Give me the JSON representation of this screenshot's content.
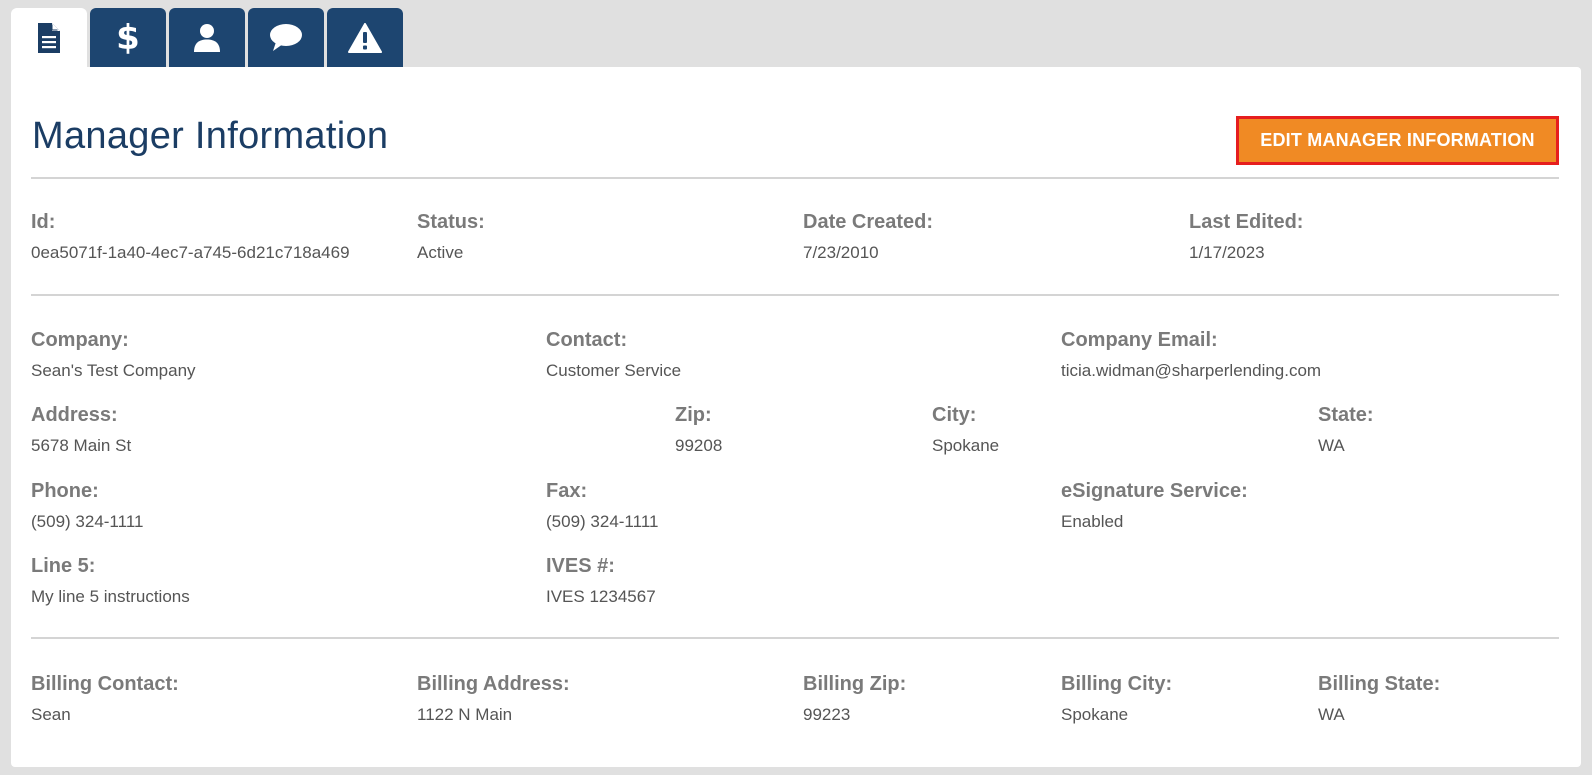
{
  "tabs": [
    {
      "name": "document",
      "icon": "document-icon",
      "active": true
    },
    {
      "name": "billing",
      "icon": "dollar-icon",
      "symbol": "$",
      "active": false
    },
    {
      "name": "user",
      "icon": "user-icon",
      "active": false
    },
    {
      "name": "comments",
      "icon": "chat-bubble-icon",
      "active": false
    },
    {
      "name": "alerts",
      "icon": "warning-icon",
      "active": false
    }
  ],
  "header": {
    "title": "Manager Information",
    "edit_button_label": "EDIT MANAGER INFORMATION"
  },
  "colors": {
    "tab_bg": "#1d4570",
    "title": "#1b3d64",
    "button_bg": "#f08a24",
    "button_border": "#e61e1e",
    "label": "#7a7a7a",
    "value": "#555555"
  },
  "meta": {
    "id": {
      "label": "Id:",
      "value": "0ea5071f-1a40-4ec7-a745-6d21c718a469"
    },
    "status": {
      "label": "Status:",
      "value": "Active"
    },
    "date_created": {
      "label": "Date Created:",
      "value": "7/23/2010"
    },
    "last_edited": {
      "label": "Last Edited:",
      "value": "1/17/2023"
    }
  },
  "details": {
    "company": {
      "label": "Company:",
      "value": "Sean's Test Company"
    },
    "contact": {
      "label": "Contact:",
      "value": "Customer Service"
    },
    "company_email": {
      "label": "Company Email:",
      "value": "ticia.widman@sharperlending.com"
    },
    "address": {
      "label": "Address:",
      "value": "5678 Main St"
    },
    "zip": {
      "label": "Zip:",
      "value": "99208"
    },
    "city": {
      "label": "City:",
      "value": "Spokane"
    },
    "state": {
      "label": "State:",
      "value": "WA"
    },
    "phone": {
      "label": "Phone:",
      "value": "(509) 324-1111"
    },
    "fax": {
      "label": "Fax:",
      "value": "(509) 324-1111"
    },
    "esignature": {
      "label": "eSignature Service:",
      "value": "Enabled"
    },
    "line5": {
      "label": "Line 5:",
      "value": "My line 5 instructions"
    },
    "ives": {
      "label": "IVES #:",
      "value": "IVES 1234567"
    }
  },
  "billing": {
    "contact": {
      "label": "Billing Contact:",
      "value": "Sean"
    },
    "address": {
      "label": "Billing Address:",
      "value": "1122 N Main"
    },
    "zip": {
      "label": "Billing Zip:",
      "value": "99223"
    },
    "city": {
      "label": "Billing City:",
      "value": "Spokane"
    },
    "state": {
      "label": "Billing State:",
      "value": "WA"
    }
  }
}
